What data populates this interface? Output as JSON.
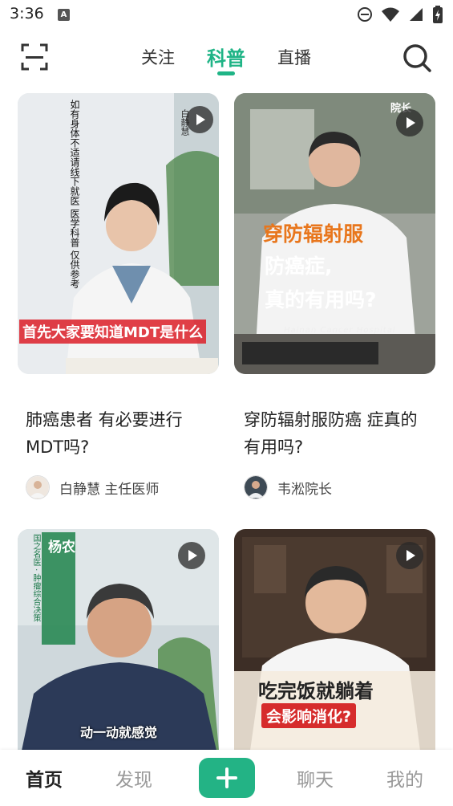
{
  "status": {
    "time": "3:36",
    "indicator": "A"
  },
  "top_nav": {
    "tabs": [
      "关注",
      "科普",
      "直播"
    ],
    "active_tab": "科普"
  },
  "videos": [
    {
      "title": "肺癌患者 有必要进行MDT吗?",
      "author": "白静慧 主任医师",
      "overlay_caption": "首先大家要知道MDT是什么",
      "disclaimer": "如有身体不适请线下就医 医学科普 仅供参考",
      "side_label": "白静慧"
    },
    {
      "title": "穿防辐射服防癌 症真的有用吗?",
      "author": "韦淞院长",
      "overlay_caption_1": "穿防辐射服",
      "overlay_caption_2": "防癌症,",
      "overlay_caption_3": "真的有用吗?",
      "hospital_text": "Hainan Cancer Hospital",
      "badge": "院长"
    },
    {
      "title": "",
      "author": "",
      "overlay_caption": "动一动就感觉",
      "side_name": "杨农",
      "side_label": "国之名医 · 肿瘤综合决策"
    },
    {
      "title": "",
      "author": "",
      "overlay_caption_1": "吃完饭就躺着",
      "overlay_caption_2": "会影响消化?"
    }
  ],
  "bottom_nav": {
    "home": "首页",
    "discover": "发现",
    "chat": "聊天",
    "mine": "我的"
  },
  "colors": {
    "accent": "#1fb486",
    "text": "#222222",
    "muted": "#999999"
  }
}
